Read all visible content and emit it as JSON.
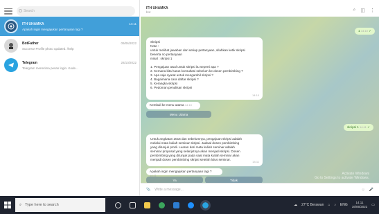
{
  "window": {
    "minimize": "–",
    "maximize": "☐",
    "close": "✕"
  },
  "left": {
    "search_placeholder": "Search",
    "chats": [
      {
        "name": "ITH UHAMKA",
        "time": "14:11",
        "message": "Apakah ingin mengajukan pertanyaan lagi ?"
      },
      {
        "name": "BotFather",
        "time": "09/06/2022",
        "message": "Success! Profile photo updated. /help"
      },
      {
        "name": "Telegram",
        "time": "28/10/2022",
        "message": "Telegram menerima pesan login. Kode..."
      }
    ]
  },
  "header": {
    "title": "ITH UHAMKA",
    "subtitle": "bot"
  },
  "messages": {
    "top_out": "1",
    "top_out_time": "14:10",
    "bubble1": {
      "lines": [
        "Skripsi",
        "Note :",
        "untuk melihat jawaban dari setiap pertanyaan, silahkan ketik skripsi",
        "beserta no pertanyaan",
        "misal : skripsi 1",
        "",
        "1. Pengajuan awal untuk skripsi itu seperti apa ?",
        "2. Kemana kita harus konsultasi sebelum ke dosen pembimbing ?",
        "3. Apa saja syarat untuk mengambil skripsi ?",
        "4. Bagaimana cara daftar skripsi ?",
        "5. Kerangka skripsi",
        "6. Pedoman penulisan skripsi"
      ],
      "time": "14:10"
    },
    "back_text": "Kembali ke menu utama",
    "back_time": "14:10",
    "menu_button": "Menu Utama",
    "mid_out": "skripsi 1",
    "mid_out_time": "14:11",
    "bubble2": {
      "lines": [
        "Untuk angkatan 2016 dan sebelumnya, pengajuan skripsi adalah",
        "melalui mata kuliah seminar skripsi. Jadwal dosen pembimbing",
        "yang ditunjuk prodi. Luaran dari mata kuliah seminar adalah",
        "seminar proposal yang selanjutnya akan menjadi skripsi. Dosen",
        "pembimbing yang ditunjuk pada saat mata kuliah seminar akan",
        "menjadi dosen pembimbing skripsi setelah lulus seminar."
      ],
      "time": "14:11"
    },
    "ask_text": "Apakah ingin mengajukan pertanyaan lagi ?",
    "ask_time": "14:11",
    "yes_button": "Ya",
    "no_button": "Tidak"
  },
  "watermark": [
    "Activate Windows",
    "Go to Settings to activate Windows."
  ],
  "composer": {
    "placeholder": "Write a message..."
  },
  "taskbar": {
    "search_placeholder": "Type here to search",
    "weather": "27°C Berawan",
    "lang": "ENG",
    "time": "14:11",
    "date": "16/06/2022"
  },
  "colors": {
    "accent": "#419fd9",
    "outgoing": "#e2f7cb",
    "taskbar": "#1f2430"
  }
}
